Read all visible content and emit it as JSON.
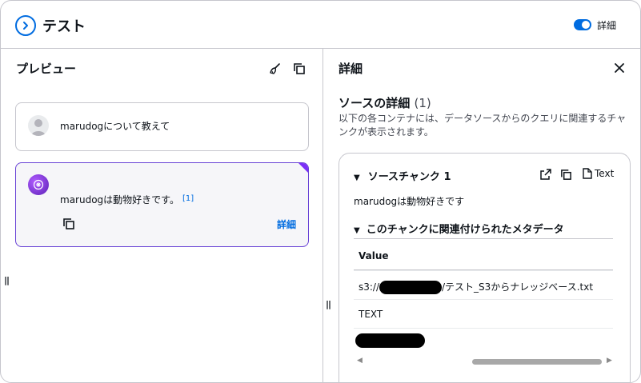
{
  "header": {
    "title": "テスト",
    "toggle_label": "詳細",
    "toggle_on": true,
    "accent_color": "#006ce0"
  },
  "preview": {
    "title": "プレビュー",
    "user_message": "marudogについて教えて",
    "ai_message": "marudogは動物好きです。",
    "ai_citation": "[1]",
    "ai_detail_link": "詳細",
    "ai_accent_color": "#6842d6"
  },
  "details": {
    "title": "詳細",
    "section_heading": "ソースの詳細",
    "section_count": "(1)",
    "section_description": "以下の各コンテナには、データソースからのクエリに関連するチャンクが表示されます。",
    "chunk": {
      "title": "ソースチャンク 1",
      "text_button": "Text",
      "text": "marudogは動物好きです",
      "metadata_title": "このチャンクに関連付けられたメタデータ",
      "table_header": "Value",
      "rows": {
        "uri_prefix": "s3://",
        "uri_suffix": "/テスト_S3からナレッジベース.txt",
        "type": "TEXT"
      }
    }
  },
  "icons": {
    "back": "chevron-right-circle-icon",
    "clear": "broom-icon",
    "copy": "copy-icon",
    "close": "close-icon",
    "external": "external-link-icon",
    "file": "file-icon",
    "user": "user-avatar-icon",
    "ai": "ai-avatar-icon",
    "drag": "drag-handle-icon"
  }
}
